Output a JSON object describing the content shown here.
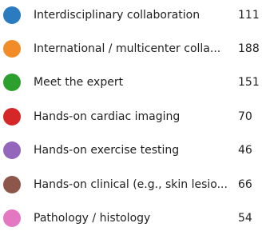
{
  "legend": {
    "items": [
      {
        "label": "Interdisciplinary collaboration",
        "count": "111",
        "color": "#2a7bc0",
        "icon": "blue-dot"
      },
      {
        "label": "International / multicenter colla...",
        "count": "188",
        "color": "#f28c28",
        "icon": "orange-dot"
      },
      {
        "label": "Meet the expert",
        "count": "151",
        "color": "#2ca02c",
        "icon": "green-dot"
      },
      {
        "label": "Hands-on cardiac imaging",
        "count": "70",
        "color": "#d62728",
        "icon": "red-dot"
      },
      {
        "label": "Hands-on exercise testing",
        "count": "46",
        "color": "#9467bd",
        "icon": "purple-dot"
      },
      {
        "label": "Hands-on clinical (e.g., skin lesio...",
        "count": "66",
        "color": "#8c564b",
        "icon": "brown-dot"
      },
      {
        "label": "Pathology / histology",
        "count": "54",
        "color": "#e377c2",
        "icon": "pink-dot"
      }
    ]
  }
}
